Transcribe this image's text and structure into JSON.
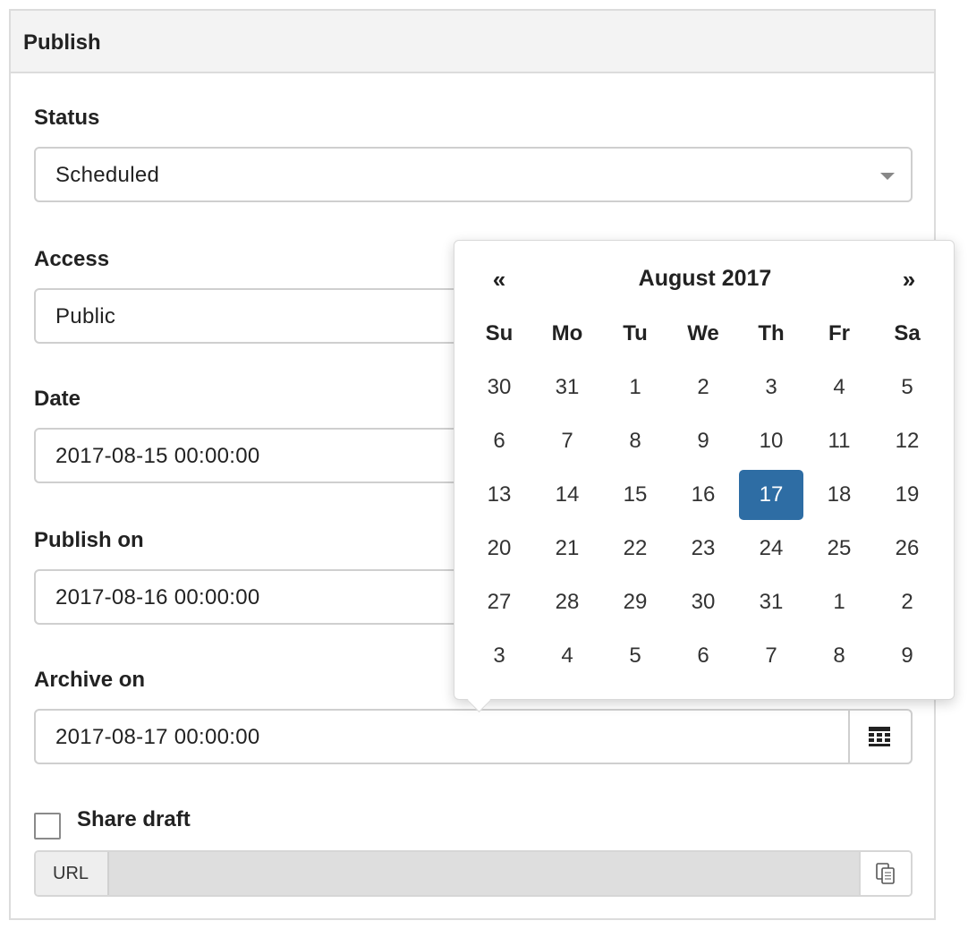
{
  "panel": {
    "title": "Publish"
  },
  "status": {
    "label": "Status",
    "value": "Scheduled"
  },
  "access": {
    "label": "Access",
    "value": "Public"
  },
  "date": {
    "label": "Date",
    "value": "2017-08-15 00:00:00"
  },
  "publish_on": {
    "label": "Publish on",
    "value": "2017-08-16 00:00:00"
  },
  "archive_on": {
    "label": "Archive on",
    "value": "2017-08-17 00:00:00",
    "icon": "calendar-icon"
  },
  "share_draft": {
    "label": "Share draft",
    "checked": false
  },
  "url": {
    "addon_label": "URL",
    "value": "",
    "copy_icon": "copy-icon"
  },
  "datepicker": {
    "prev": "«",
    "next": "»",
    "title": "August 2017",
    "weekdays": [
      "Su",
      "Mo",
      "Tu",
      "We",
      "Th",
      "Fr",
      "Sa"
    ],
    "selected_day": "17",
    "selected_color": "#2e6da4",
    "weeks": [
      [
        "30",
        "31",
        "1",
        "2",
        "3",
        "4",
        "5"
      ],
      [
        "6",
        "7",
        "8",
        "9",
        "10",
        "11",
        "12"
      ],
      [
        "13",
        "14",
        "15",
        "16",
        "17",
        "18",
        "19"
      ],
      [
        "20",
        "21",
        "22",
        "23",
        "24",
        "25",
        "26"
      ],
      [
        "27",
        "28",
        "29",
        "30",
        "31",
        "1",
        "2"
      ],
      [
        "3",
        "4",
        "5",
        "6",
        "7",
        "8",
        "9"
      ]
    ]
  }
}
